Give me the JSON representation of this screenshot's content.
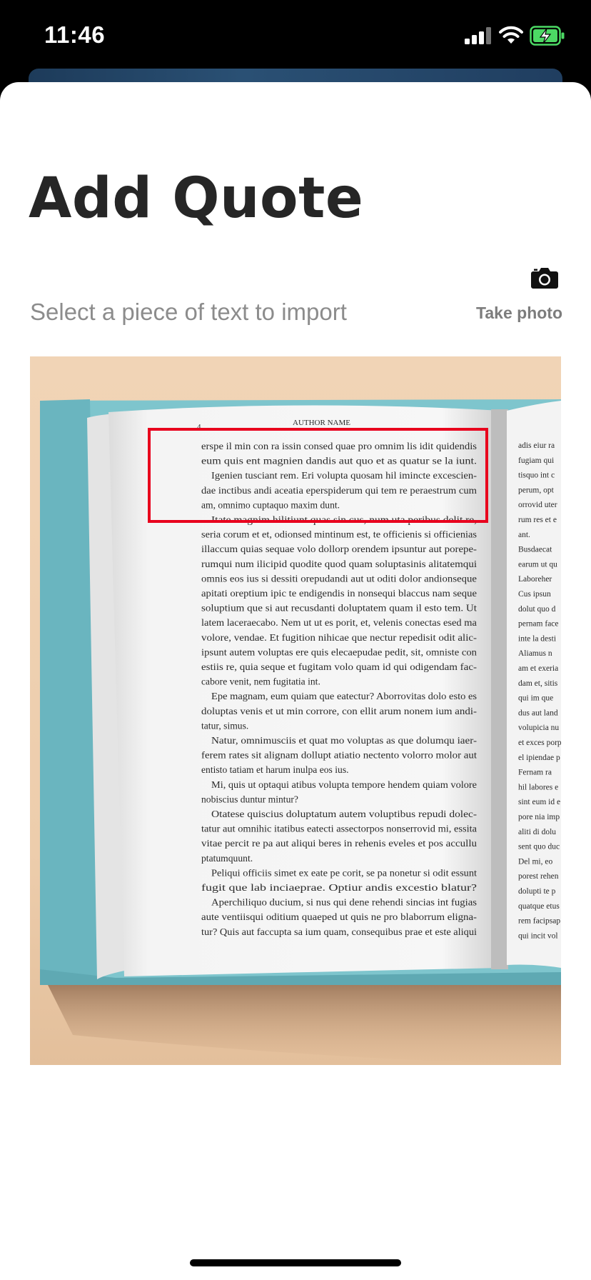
{
  "status_bar": {
    "time": "11:46",
    "icons": [
      "cellular-signal-icon",
      "wifi-icon",
      "battery-charging-icon"
    ],
    "battery_color": "#4cd964"
  },
  "sheet": {
    "title": "Add Quote",
    "subtitle": "Select a piece of text to import",
    "take_photo_label": "Take photo",
    "take_photo_icon": "camera-icon"
  },
  "photo": {
    "selection_color": "#e8001d",
    "book_text": {
      "header": "AUTHOR NAME",
      "page_number": "4",
      "main_page_lines": [
        "erspe il min con ra issin consed quae pro omnim lis idit quidendis",
        "eum quis ent magnien dandis aut quo et as quatur se la iunt.",
        "Igenien tusciant rem. Eri volupta quosam hil imincte excescien-",
        "dae inctibus andi aceatia eperspiderum qui tem re peraestrum cum",
        "am, omnimo cuptaquo maxim dunt.",
        "Itate magnim hilitiunt quas sin cus, num uta peribus delit re,",
        "seria corum et et, odionsed mintinum est, te officienis si officienias",
        "illaccum quias sequae volo dollorp orendem ipsuntur aut porepe-",
        "rumqui num ilicipid quodite quod quam soluptasinis alitatemqui",
        "omnis eos ius si dessiti orepudandi aut ut oditi dolor andionseque",
        "apitati oreptium ipic te endigendis in nonsequi blaccus nam seque",
        "soluptium que si aut recusdanti doluptatem quam il esto tem. Ut",
        "latem laceraecabo. Nem ut ut es porit, et, velenis conectas esed ma",
        "volore, vendae. Et fugition nihicae que nectur repedisit odit alic-",
        "ipsunt autem voluptas ere quis elecaepudae pedit, sit, omniste con",
        "estiis re, quia seque et fugitam volo quam id qui odigendam fac-",
        "cabore venit, nem fugitatia int.",
        "Epe magnam, eum quiam que eatectur? Aborrovitas dolo esto es",
        "doluptas venis et ut min corrore, con ellit arum nonem ium andi-",
        "tatur, simus.",
        "Natur, omnimusciis et quat mo voluptas as que dolumqu iaer-",
        "ferem rates sit alignam dollupt atiatio nectento volorro molor aut",
        "entisto tatiam et harum inulpa eos ius.",
        "Mi, quis ut optaqui atibus volupta tempore hendem quiam volore",
        "nobiscius duntur mintur?",
        "Otatese quiscius doluptatum autem voluptibus repudi dolec-",
        "tatur aut omnihic itatibus eatecti assectorpos nonserrovid mi, essita",
        "vitae percit re pa aut aliqui beres in rehenis eveles et pos accullu",
        "ptatumquunt.",
        "Peliqui officiis simet ex eate pe corit, se pa nonetur si odit essunt",
        "fugit que lab inciaeprae. Optiur andis excestio blatur?",
        "Aperchiliquo ducium, si nus qui dene rehendi sincias int fugias",
        "aute ventiisqui oditium quaeped ut quis ne pro blaborrum eligna-",
        "tur? Quis aut faccupta sa ium quam, consequibus prae et este aliqui"
      ],
      "right_page_lines": [
        "adis eiur ra",
        "fugiam qui",
        "tisquo int c",
        "perum, opt",
        "orrovid uter",
        "rum res et e",
        "ant.",
        "Busdaecat",
        "earum ut qu",
        "Laboreher",
        "Cus ipsun",
        "dolut quo d",
        "pernam face",
        "inte la desti",
        "Aliamus n",
        "am et exeria",
        "dam et, sitis",
        "qui im que",
        "dus aut land",
        "volupicia nu",
        "et exces porp",
        "el ipiendae p",
        "Fernam ra",
        "hil labores e",
        "sint eum id e",
        "pore nia imp",
        "aliti di dolu",
        "sent quo duc",
        "Del mi, eo",
        "porest rehen",
        "dolupti te p",
        "quatque etus",
        "rem facipsap",
        "qui incit vol"
      ]
    }
  }
}
